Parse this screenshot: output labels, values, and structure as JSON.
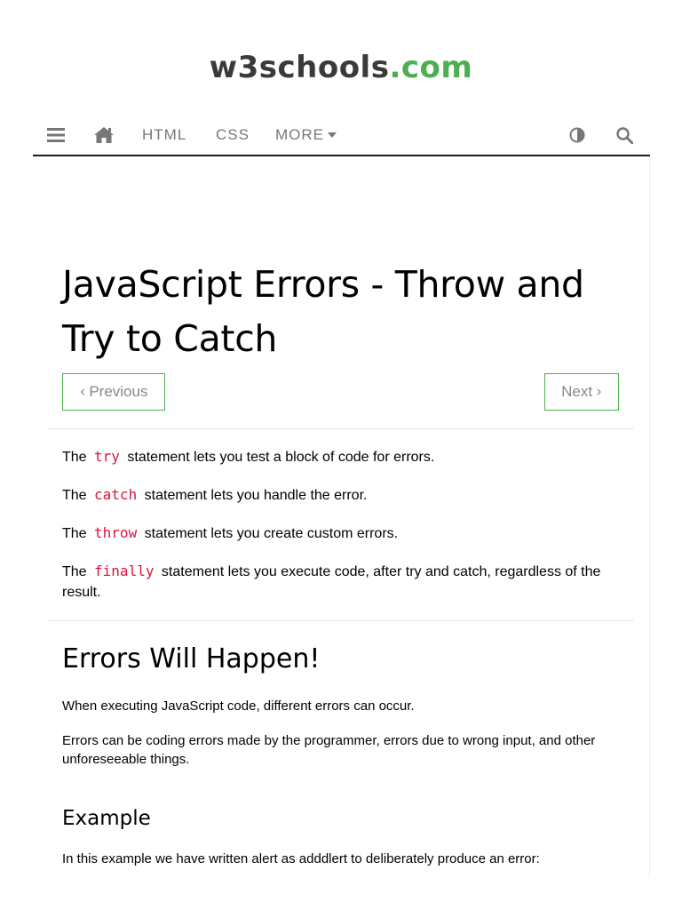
{
  "logo": {
    "main": "w3schools",
    "tld": ".com"
  },
  "nav": {
    "menu_icon": "hamburger-icon",
    "home_icon": "home-icon",
    "html_label": "HTML",
    "css_label": "CSS",
    "more_label": "MORE",
    "theme_icon": "contrast-icon",
    "search_icon": "search-icon"
  },
  "page": {
    "title": "JavaScript Errors - Throw and Try to Catch",
    "prev_label": "Previous",
    "next_label": "Next"
  },
  "intro": [
    {
      "pre": "The",
      "keyword": "try",
      "post": "statement lets you test a block of code for errors."
    },
    {
      "pre": "The",
      "keyword": "catch",
      "post": "statement lets you handle the error."
    },
    {
      "pre": "The",
      "keyword": "throw",
      "post": "statement lets you create custom errors."
    },
    {
      "pre": "The",
      "keyword": "finally",
      "post": "statement lets you execute code, after try and catch, regardless of the result."
    }
  ],
  "section": {
    "heading": "Errors Will Happen!",
    "p1": "When executing JavaScript code, different errors can occur.",
    "p2": "Errors can be coding errors made by the programmer, errors due to wrong input, and other unforeseeable things.",
    "example_heading": "Example",
    "example_text": "In this example we have written alert as adddlert to deliberately produce an error:"
  },
  "colors": {
    "accent": "#4caf50",
    "keyword": "#dc143c",
    "nav_text": "#777777"
  }
}
